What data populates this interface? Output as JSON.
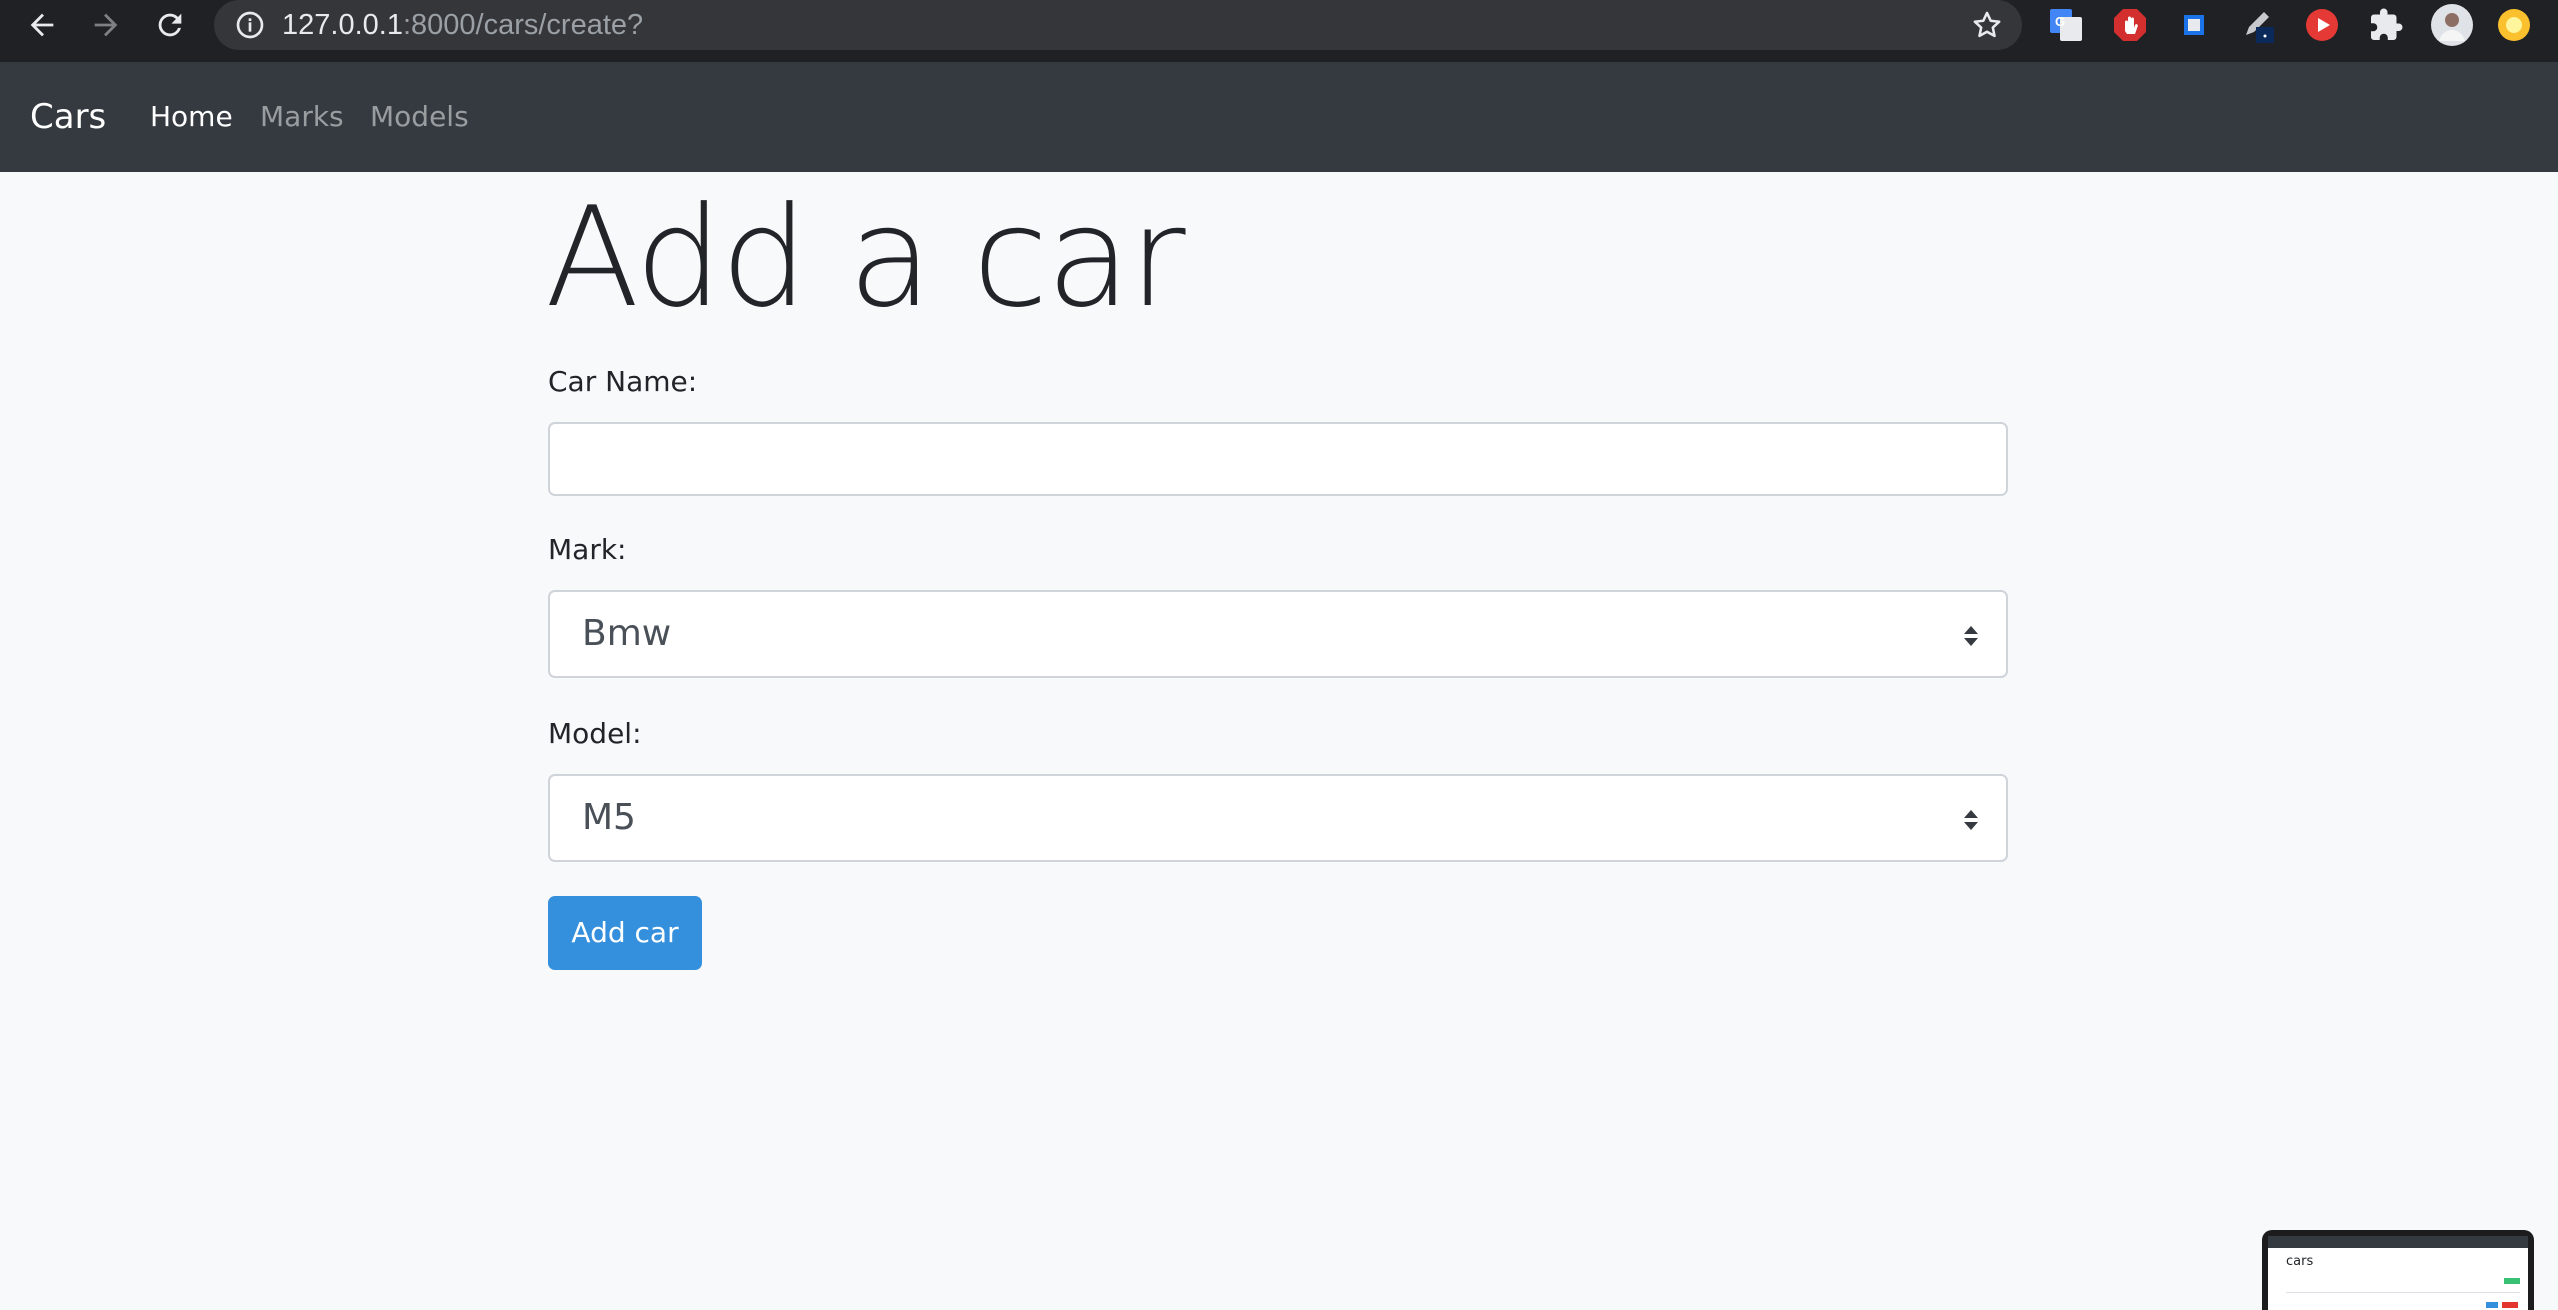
{
  "browser": {
    "url_host": "127.0.0.1",
    "url_path": ":8000/cars/create?",
    "icons": [
      "back-arrow-icon",
      "forward-arrow-icon",
      "reload-icon",
      "site-info-icon",
      "bookmark-star-icon",
      "google-translate-extension-icon",
      "adblock-extension-icon",
      "blue-square-extension-icon",
      "pen-extension-icon",
      "youtube-extension-icon",
      "extensions-puzzle-icon",
      "profile-avatar",
      "yellow-extension-icon"
    ]
  },
  "navbar": {
    "brand": "Cars",
    "links": [
      {
        "label": "Home",
        "active": true
      },
      {
        "label": "Marks",
        "active": false
      },
      {
        "label": "Models",
        "active": false
      }
    ]
  },
  "page": {
    "title": "Add a car"
  },
  "form": {
    "car_name_label": "Car Name:",
    "car_name_value": "",
    "mark_label": "Mark:",
    "mark_selected": "Bmw",
    "model_label": "Model:",
    "model_selected": "M5",
    "submit_label": "Add car"
  },
  "preview_thumbnail": {
    "title": "cars"
  },
  "colors": {
    "chrome_bg": "#202124",
    "navbar_bg": "#343a40",
    "page_bg": "#f8f9fa",
    "primary": "#3490dc",
    "input_border": "#ced4da"
  }
}
